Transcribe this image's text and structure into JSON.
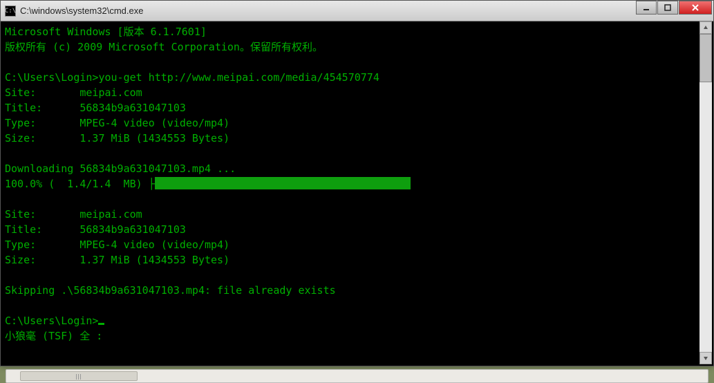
{
  "window": {
    "title": "C:\\windows\\system32\\cmd.exe",
    "icon_label": "C:\\"
  },
  "console": {
    "line_ms": "Microsoft Windows [版本 6.1.7601]",
    "line_copy": "版权所有 (c) 2009 Microsoft Corporation。保留所有权利。",
    "prompt1": "C:\\Users\\Login>",
    "cmd1": "you-get http://www.meipai.com/media/454570774",
    "site_label": "Site:       ",
    "site_val": "meipai.com",
    "title_label": "Title:      ",
    "title_val": "56834b9a631047103",
    "type_label": "Type:       ",
    "type_val": "MPEG-4 video (video/mp4)",
    "size_label": "Size:       ",
    "size_val": "1.37 MiB (1434553 Bytes)",
    "downloading": "Downloading 56834b9a631047103.mp4 ...",
    "progress_text": "100.0% (  1.4/1.4  MB) ├",
    "skipping": "Skipping .\\56834b9a631047103.mp4: file already exists",
    "prompt2": "C:\\Users\\Login>",
    "ime": "小狼毫 (TSF) 全 :"
  }
}
